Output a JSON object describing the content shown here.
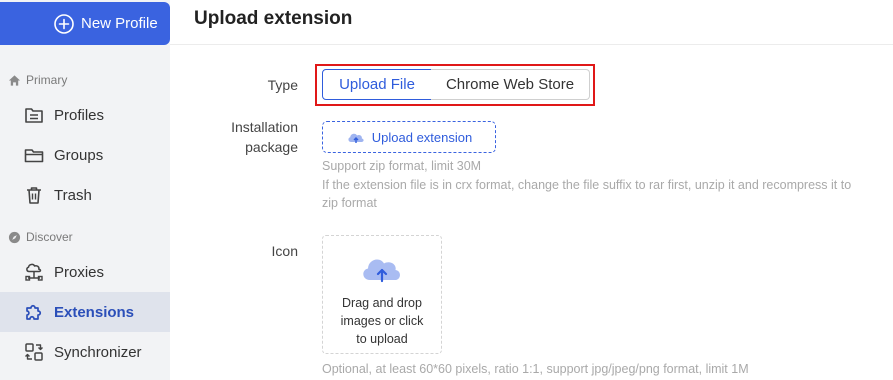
{
  "sidebar": {
    "new_profile_label": "New Profile",
    "primary_section": "Primary",
    "discover_section": "Discover",
    "items": [
      {
        "label": "Profiles",
        "icon": "profiles-icon"
      },
      {
        "label": "Groups",
        "icon": "folder-icon"
      },
      {
        "label": "Trash",
        "icon": "trash-icon"
      },
      {
        "label": "Proxies",
        "icon": "proxies-icon"
      },
      {
        "label": "Extensions",
        "icon": "puzzle-icon",
        "active": true
      },
      {
        "label": "Synchronizer",
        "icon": "synchronizer-icon"
      }
    ]
  },
  "main": {
    "title": "Upload extension",
    "type_label": "Type",
    "type_options": [
      "Upload File",
      "Chrome Web Store"
    ],
    "type_selected": "Upload File",
    "package_label_line1": "Installation",
    "package_label_line2": "package",
    "upload_button_label": "Upload extension",
    "package_hint_1": "Support zip format, limit 30M",
    "package_hint_2": "If the extension file is in crx format, change the file suffix to rar first, unzip it and recompress it to",
    "package_hint_3": "zip format",
    "icon_label": "Icon",
    "dropzone_text": "Drag and drop images or click to upload",
    "icon_hint": "Optional, at least 60*60 pixels, ratio 1:1, support jpg/jpeg/png format, limit 1M"
  },
  "colors": {
    "accent": "#3a63e0",
    "highlight": "#e01818",
    "sidebar_bg": "#f2f3f5"
  }
}
